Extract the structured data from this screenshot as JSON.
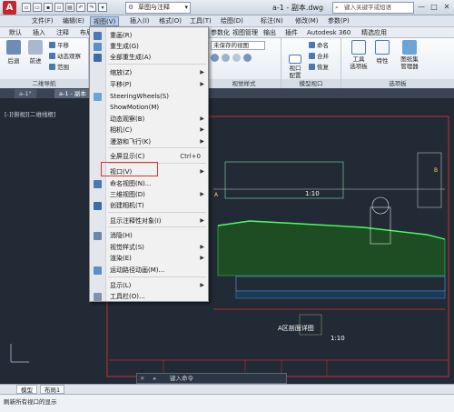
{
  "app": {
    "logo_letter": "A",
    "document_title": "a-1 - 副本.dwg"
  },
  "workspace": {
    "label": "草图与注释"
  },
  "search": {
    "placeholder": "键入关键字或短语"
  },
  "window_controls": [
    "—",
    "□",
    "✕"
  ],
  "menubar": {
    "items": [
      "文件(F)",
      "编辑(E)",
      "视图(V)",
      "插入(I)",
      "格式(O)",
      "工具(T)",
      "绘图(D)",
      "标注(N)",
      "修改(M)",
      "参数(P)"
    ],
    "active_index": 2
  },
  "ribbon_tabs": [
    "默认",
    "插入",
    "注释",
    "布局",
    "参数化",
    "视图",
    "管理",
    "输出",
    "插件",
    "Autodesk 360",
    "精选应用"
  ],
  "ribbon": {
    "nav_panel": {
      "title": "二维导航",
      "back": "后退",
      "forward": "前进",
      "pan": "平移",
      "orbit": "动态观察",
      "range": "范围"
    },
    "style_dropdown": "未保存的视图",
    "view_style_panel": {
      "title": "视觉样式"
    },
    "viewport_panel": {
      "title": "模型视口",
      "config": "视口\n配置",
      "named": "命名",
      "join": "合并",
      "restore": "恢复"
    },
    "palettes_panel": {
      "title": "选项板",
      "tool_palettes": "工具\n选项板",
      "properties": "特性",
      "sheet_set": "图纸集\n管理器"
    }
  },
  "file_tabs": [
    "a-1°",
    "a-1 - 副本"
  ],
  "viewport_label": "[-][俯视][二维线框]",
  "dropdown": {
    "items": [
      {
        "label": "重画(R)",
        "shortcut": "",
        "submenu": false,
        "icon": "redraw-icon"
      },
      {
        "label": "重生成(G)",
        "shortcut": "",
        "submenu": false,
        "icon": "regen-icon"
      },
      {
        "label": "全部重生成(A)",
        "shortcut": "",
        "submenu": false,
        "icon": "regen-all-icon"
      },
      {
        "label": "缩放(Z)",
        "shortcut": "",
        "submenu": true,
        "icon": ""
      },
      {
        "label": "平移(P)",
        "shortcut": "",
        "submenu": true,
        "icon": ""
      },
      {
        "label": "SteeringWheels(S)",
        "shortcut": "",
        "submenu": false,
        "icon": "steeringwheel-icon"
      },
      {
        "label": "ShowMotion(M)",
        "shortcut": "",
        "submenu": false,
        "icon": ""
      },
      {
        "label": "动态观察(B)",
        "shortcut": "",
        "submenu": true,
        "icon": ""
      },
      {
        "label": "相机(C)",
        "shortcut": "",
        "submenu": true,
        "icon": ""
      },
      {
        "label": "漫游和飞行(K)",
        "shortcut": "",
        "submenu": true,
        "icon": ""
      },
      {
        "label": "全屏显示(C)",
        "shortcut": "Ctrl+0",
        "submenu": false,
        "icon": ""
      },
      {
        "label": "视口(V)",
        "shortcut": "",
        "submenu": true,
        "icon": ""
      },
      {
        "label": "命名视图(N)...",
        "shortcut": "",
        "submenu": false,
        "icon": "named-view-icon"
      },
      {
        "label": "三维视图(D)",
        "shortcut": "",
        "submenu": true,
        "icon": ""
      },
      {
        "label": "创建相机(T)",
        "shortcut": "",
        "submenu": false,
        "icon": "camera-icon"
      },
      {
        "label": "显示注释性对象(I)",
        "shortcut": "",
        "submenu": true,
        "icon": ""
      },
      {
        "label": "消隐(H)",
        "shortcut": "",
        "submenu": false,
        "icon": "hide-icon"
      },
      {
        "label": "视觉样式(S)",
        "shortcut": "",
        "submenu": true,
        "icon": ""
      },
      {
        "label": "渲染(E)",
        "shortcut": "",
        "submenu": true,
        "icon": ""
      },
      {
        "label": "运动路径动画(M)...",
        "shortcut": "",
        "submenu": false,
        "icon": "motion-path-icon"
      },
      {
        "label": "显示(L)",
        "shortcut": "",
        "submenu": true,
        "icon": ""
      },
      {
        "label": "工具栏(O)...",
        "shortcut": "",
        "submenu": false,
        "icon": "toolbar-icon"
      }
    ],
    "highlighted_index": 11
  },
  "drawing": {
    "scale_label_1": "1:10",
    "scale_label_2": "1:10",
    "section_title": "A区剖面详图",
    "annotation_1": "A",
    "annotation_2": "B"
  },
  "command_line": {
    "placeholder": "键入命令"
  },
  "layout_tabs": [
    "模型",
    "布局1"
  ],
  "status": {
    "text": "刷新所有视口的显示"
  },
  "colors": {
    "accent": "#c4262e",
    "highlight_box": "#e0322f",
    "viewport_bg": "#222a35"
  }
}
